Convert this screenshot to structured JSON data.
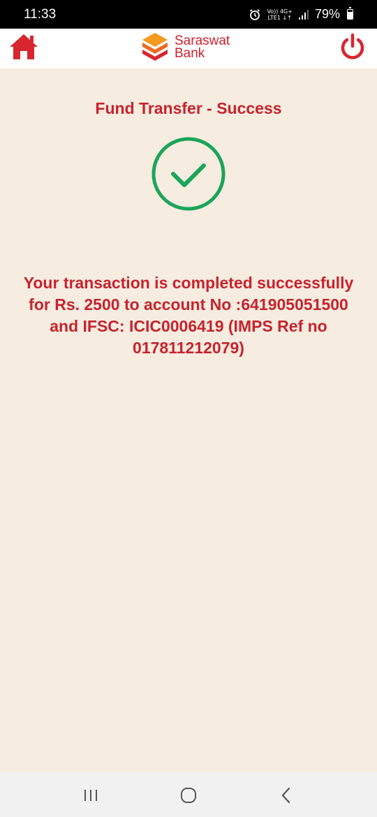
{
  "status_bar": {
    "time": "11:33",
    "network_top": "Vo)) 4G+",
    "network_bottom": "LTE1 ↓↑",
    "battery": "79%",
    "battery_level": 0.79
  },
  "header": {
    "logo_line1": "Saraswat",
    "logo_line2": "Bank",
    "home_icon": "home-icon",
    "power_icon": "power-icon"
  },
  "main": {
    "title": "Fund Transfer - Success",
    "message": "Your transaction is completed successfully for Rs. 2500 to account No :641905051500 and IFSC: ICIC0006419 (IMPS Ref no 017811212079)"
  },
  "nav": {
    "recents_icon": "recents-icon",
    "home_icon": "home-circle-icon",
    "back_icon": "back-icon"
  },
  "colors": {
    "brand_red": "#c6232e",
    "success_green": "#1aa55a",
    "background": "#f6ece0"
  }
}
